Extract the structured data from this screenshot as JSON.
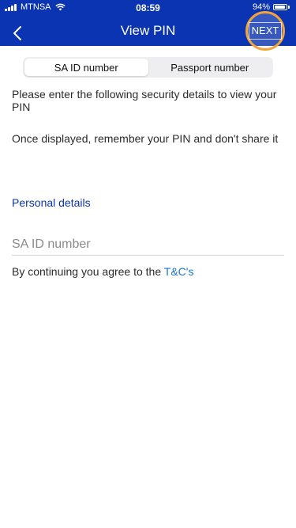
{
  "status_bar": {
    "carrier": "MTNSA",
    "time": "08:59",
    "battery": "94%",
    "battery_level": 0.94
  },
  "nav": {
    "title": "View PIN",
    "next_label": "NEXT",
    "back_icon": "chevron-left-icon"
  },
  "tabs": [
    {
      "label": "SA ID number",
      "active": true
    },
    {
      "label": "Passport number",
      "active": false
    }
  ],
  "content": {
    "instruction": "Please enter the following security details to view your PIN",
    "reminder": "Once displayed, remember your PIN and don't share it",
    "section_title": "Personal details",
    "id_field": {
      "value": "",
      "placeholder": "SA ID number"
    },
    "terms_prefix": "By continuing you agree to the ",
    "terms_link": "T&C's"
  },
  "colors": {
    "brand_blue": "#0a34b1",
    "highlight_orange": "#f2a33a",
    "link_blue": "#1a73d9"
  }
}
